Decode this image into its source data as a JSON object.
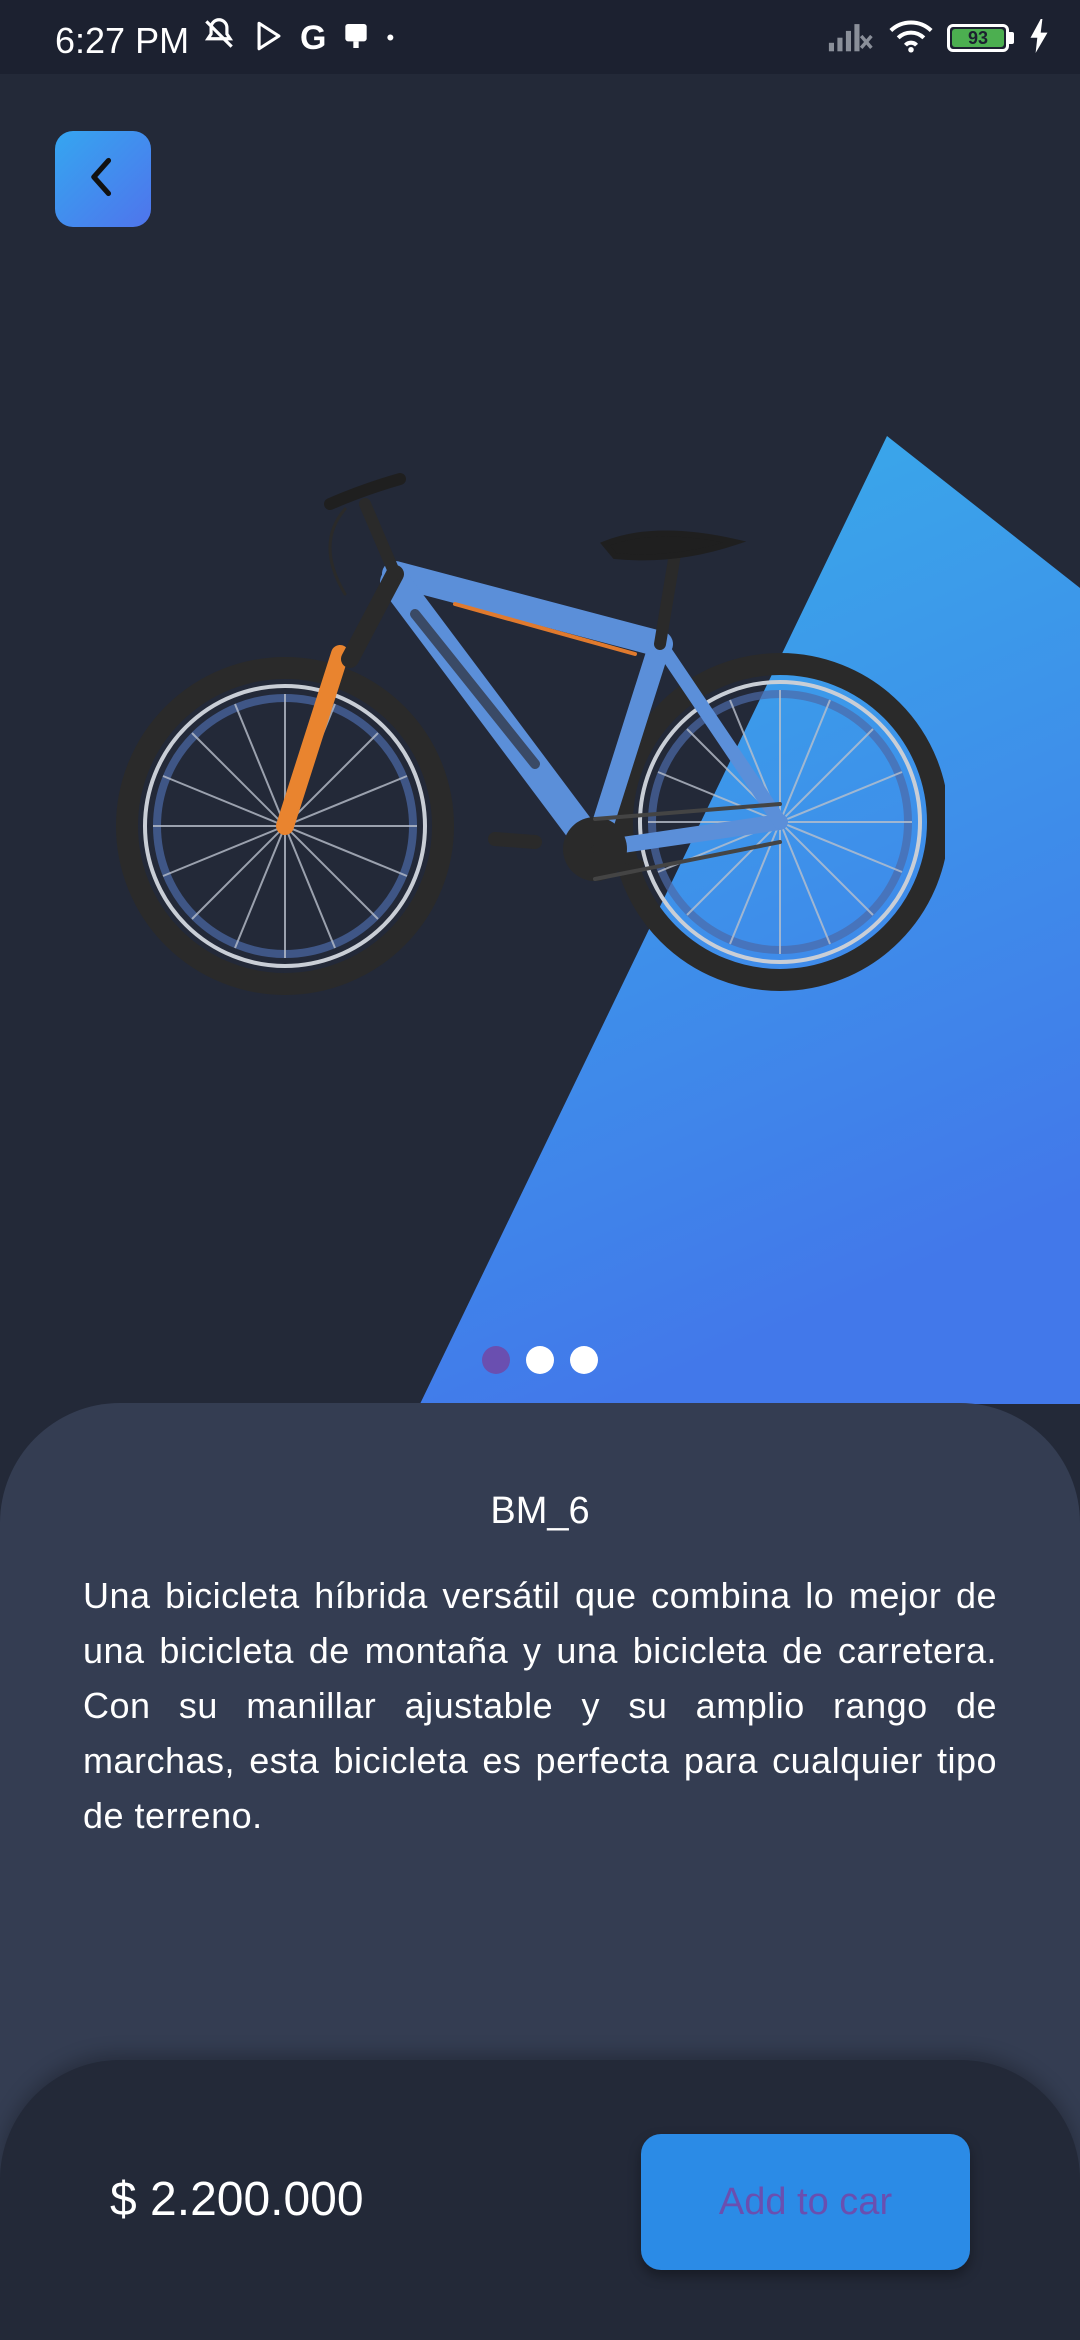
{
  "status_bar": {
    "time": "6:27 PM",
    "left_icons": [
      "mute-icon",
      "play-store-icon",
      "google-icon",
      "notification-icon",
      "dot-icon"
    ],
    "right_icons": [
      "signal-icon",
      "wifi-icon",
      "battery-icon",
      "charging-icon"
    ],
    "battery_level": "93"
  },
  "product": {
    "name": "BM_6",
    "description": "Una bicicleta híbrida versátil que combina lo mejor de una bicicleta de montaña y una bicicleta de carretera. Con su manillar ajustable y su amplio rango de marchas, esta bicicleta es perfecta para cualquier tipo de terreno.",
    "price": "$ 2.200.000",
    "image_icon": "bicycle-image"
  },
  "carousel": {
    "count": 3,
    "active_index": 0
  },
  "actions": {
    "add_label": "Add to car"
  },
  "colors": {
    "background": "#232938",
    "panel": "#343d52",
    "accent_gradient_start": "#38b0ea",
    "accent_gradient_end": "#4278ea",
    "button": "#2b8be6",
    "button_text": "#6a4fb0",
    "active_dot": "#6a4fb0"
  }
}
